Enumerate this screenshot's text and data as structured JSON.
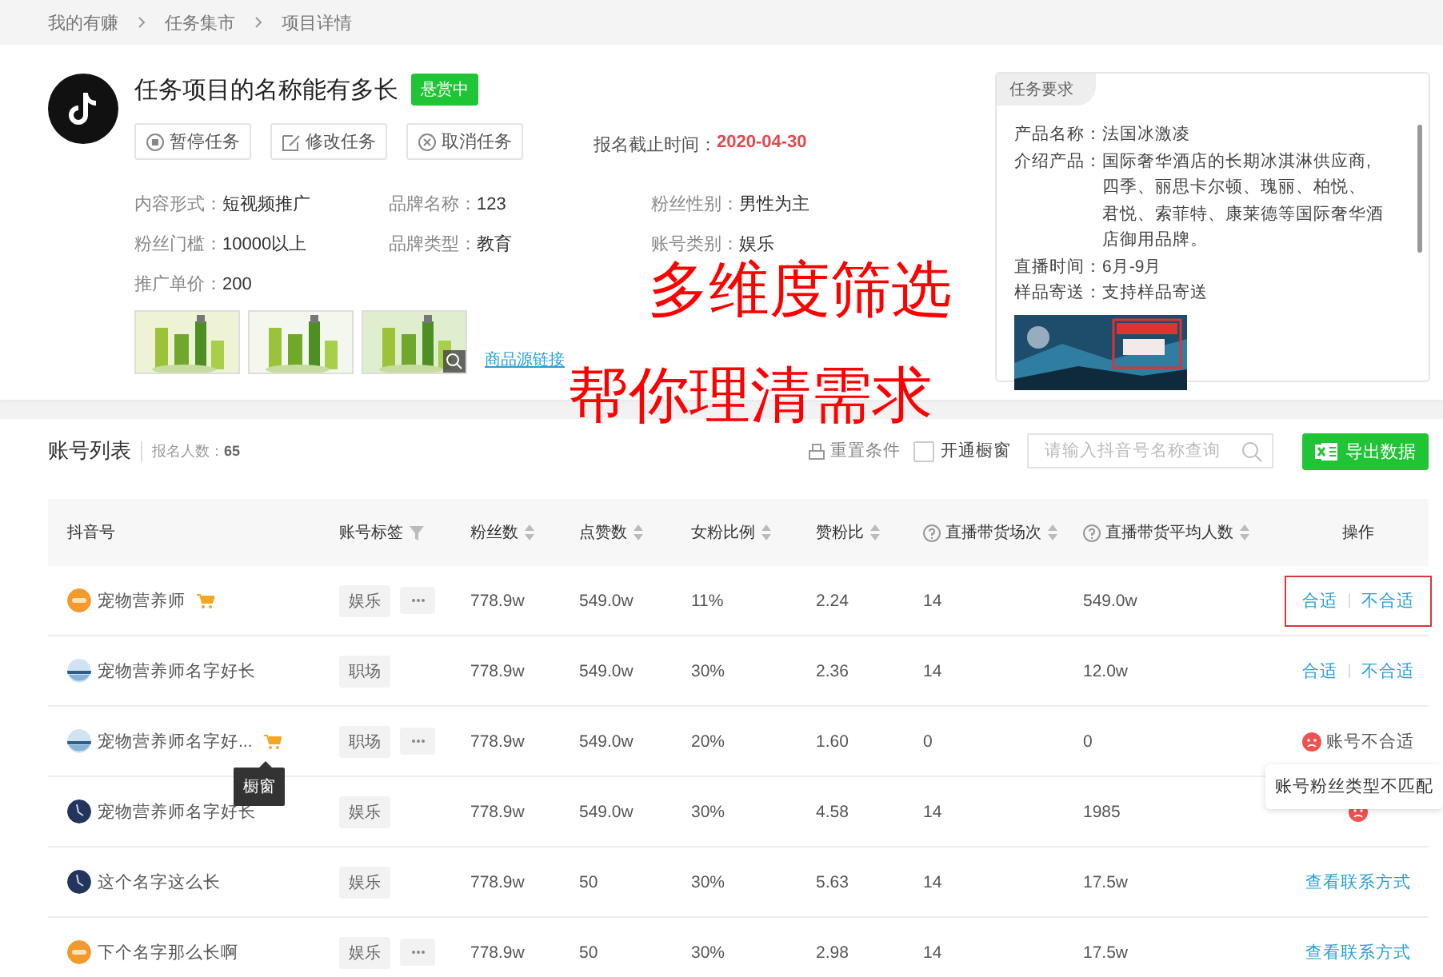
{
  "breadcrumb": [
    "我的有赚",
    "任务集市",
    "项目详情"
  ],
  "task": {
    "title": "任务项目的名称能有多长",
    "status": "悬赏中",
    "actions": [
      {
        "kind": "pause",
        "label": "暂停任务"
      },
      {
        "kind": "edit",
        "label": "修改任务"
      },
      {
        "kind": "cancel",
        "label": "取消任务"
      }
    ],
    "deadline_label": "报名截止时间：",
    "deadline": "2020-04-30",
    "info": [
      {
        "label": "内容形式：",
        "value": "短视频推广"
      },
      {
        "label": "品牌名称：",
        "value": "123"
      },
      {
        "label": "粉丝性别：",
        "value": "男性为主"
      },
      {
        "label": "粉丝门槛：",
        "value": "10000以上"
      },
      {
        "label": "品牌类型：",
        "value": "教育"
      },
      {
        "label": "账号类别：",
        "value": "娱乐"
      },
      {
        "label": "推广单价：",
        "value": "200"
      }
    ],
    "source_link": "商品源链接"
  },
  "requirements": {
    "tab": "任务要求",
    "lines": [
      {
        "label": "产品名称：",
        "value": "法国冰激凌"
      },
      {
        "label": "介绍产品：",
        "values": [
          "国际奢华酒店的长期冰淇淋供应商,",
          "四季、丽思卡尔顿、瑰丽、柏悦、",
          "君悦、索菲特、康莱德等国际奢华酒",
          "店御用品牌。"
        ]
      },
      {
        "label": "直播时间：",
        "value": "6月-9月"
      },
      {
        "label": "样品寄送：",
        "value": "支持样品寄送"
      }
    ]
  },
  "captions": [
    "多维度筛选",
    "帮你理清需求"
  ],
  "accounts": {
    "title": "账号列表",
    "count_label": "报名人数：",
    "count": "65",
    "reset": "重置条件",
    "shop_filter": {
      "label": "开通橱窗",
      "checked": false
    },
    "search": {
      "placeholder": "请输入抖音号名称查询"
    },
    "export": "导出数据",
    "columns": [
      {
        "label": "抖音号",
        "sort": false,
        "filter": false,
        "help": false
      },
      {
        "label": "账号标签",
        "sort": false,
        "filter": true,
        "help": false
      },
      {
        "label": "粉丝数",
        "sort": true,
        "filter": false,
        "help": false
      },
      {
        "label": "点赞数",
        "sort": true,
        "filter": false,
        "help": false
      },
      {
        "label": "女粉比例",
        "sort": true,
        "filter": false,
        "help": false
      },
      {
        "label": "赞粉比",
        "sort": true,
        "filter": false,
        "help": false
      },
      {
        "label": "直播带货场次",
        "sort": true,
        "filter": false,
        "help": true
      },
      {
        "label": "直播带货平均人数",
        "sort": true,
        "filter": false,
        "help": true
      },
      {
        "label": "操作",
        "sort": false,
        "filter": false,
        "help": false
      }
    ],
    "rows": [
      {
        "name": "宠物营养师",
        "shop_window": true,
        "tag": "娱乐",
        "more": true,
        "fans": "778.9w",
        "likes": "549.0w",
        "female": "11%",
        "ratio": "2.24",
        "sessions": "14",
        "average": "549.0w",
        "action": {
          "kind": "choose",
          "labels": [
            "合适",
            "不合适"
          ],
          "highlighted": true
        }
      },
      {
        "name": "宠物营养师名字好长",
        "shop_window": false,
        "tag": "职场",
        "more": false,
        "fans": "778.9w",
        "likes": "549.0w",
        "female": "30%",
        "ratio": "2.36",
        "sessions": "14",
        "average": "12.0w",
        "action": {
          "kind": "choose",
          "labels": [
            "合适",
            "不合适"
          ],
          "highlighted": false
        }
      },
      {
        "name": "宠物营养师名字好...",
        "shop_window": true,
        "tooltip": "橱窗",
        "tag": "职场",
        "more": true,
        "fans": "778.9w",
        "likes": "549.0w",
        "female": "20%",
        "ratio": "1.60",
        "sessions": "0",
        "average": "0",
        "action": {
          "kind": "rejected",
          "label": "账号不合适",
          "tooltip": "账号粉丝类型不匹配"
        }
      },
      {
        "name": "宠物营养师名字好长",
        "shop_window": false,
        "tag": "娱乐",
        "more": false,
        "fans": "778.9w",
        "likes": "549.0w",
        "female": "30%",
        "ratio": "4.58",
        "sessions": "14",
        "average": "1985",
        "action": {
          "kind": "rejected"
        }
      },
      {
        "name": "这个名字这么长",
        "shop_window": false,
        "tag": "娱乐",
        "more": false,
        "fans": "778.9w",
        "likes": "50",
        "female": "30%",
        "ratio": "5.63",
        "sessions": "14",
        "average": "17.5w",
        "action": {
          "kind": "contact",
          "label": "查看联系方式"
        }
      },
      {
        "name": "下个名字那么长啊",
        "shop_window": false,
        "tag": "娱乐",
        "more": true,
        "fans": "778.9w",
        "likes": "50",
        "female": "30%",
        "ratio": "2.98",
        "sessions": "14",
        "average": "17.5w",
        "action": {
          "kind": "contact",
          "label": "查看联系方式"
        }
      }
    ]
  }
}
